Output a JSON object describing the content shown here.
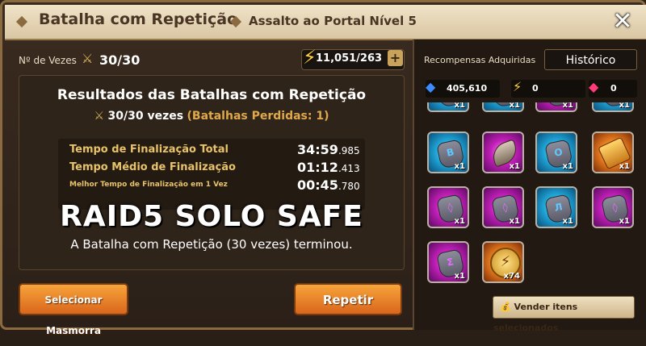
{
  "header": {
    "title": "Batalha com Repetição",
    "subtitle": "Assalto ao Portal Nível 5",
    "close_icon": "close-icon"
  },
  "left": {
    "count_label": "Nº de Vezes",
    "count_value": "30/30",
    "energy_value": "11,051/263",
    "plus_label": "+",
    "results_title": "Resultados das Batalhas com Repetição",
    "wins_text": "30/30 vezes",
    "losses_text": "(Batalhas Perdidas: 1)",
    "times": [
      {
        "label": "Tempo de Finalização Total",
        "main": "34:59",
        "ms": ".985"
      },
      {
        "label": "Tempo Médio de Finalização",
        "main": "01:12",
        "ms": ".413"
      },
      {
        "label": "Melhor Tempo de Finalização em 1 Vez",
        "main": "00:45",
        "ms": ".780"
      }
    ],
    "overlay_text": "RAID5 SOLO SAFE",
    "ended_text": "A Batalha com Repetição (30 vezes) terminou.",
    "select_dungeon_label": "Selecionar Masmorra",
    "repeat_label": "Repetir"
  },
  "right": {
    "rewards_label": "Recompensas Adquiridas",
    "history_label": "Histórico",
    "crystals": "405,610",
    "energy": "0",
    "gems": "0",
    "sell_label": "Vender itens selecionados",
    "items": [
      {
        "bg": "blue",
        "glyph": "",
        "qty": "x1"
      },
      {
        "bg": "blue",
        "glyph": "",
        "qty": "x1"
      },
      {
        "bg": "purple",
        "glyph": "",
        "qty": "x1"
      },
      {
        "bg": "blue",
        "glyph": "",
        "qty": "x1"
      },
      {
        "bg": "blue",
        "glyph": "B",
        "qty": "x1",
        "glyph_color": "#5ec8ff"
      },
      {
        "bg": "purple",
        "glyph": "",
        "qty": "x1",
        "kind": "fang"
      },
      {
        "bg": "blue",
        "glyph": "O",
        "qty": "x1",
        "glyph_color": "#5ec8ff"
      },
      {
        "bg": "orange",
        "glyph": "",
        "qty": "x1",
        "kind": "scroll"
      },
      {
        "bg": "purple",
        "glyph": "◊",
        "qty": "x1",
        "glyph_color": "#e86bff"
      },
      {
        "bg": "purple",
        "glyph": "◊",
        "qty": "x1",
        "glyph_color": "#e86bff"
      },
      {
        "bg": "blue",
        "glyph": "Л",
        "qty": "x1",
        "glyph_color": "#5ec8ff"
      },
      {
        "bg": "purple",
        "glyph": "◊",
        "qty": "x1",
        "glyph_color": "#e86bff"
      },
      {
        "bg": "purple",
        "glyph": "Σ",
        "qty": "x1",
        "glyph_color": "#e86bff"
      },
      {
        "bg": "orange",
        "glyph": "",
        "qty": "x74",
        "kind": "coin"
      }
    ]
  }
}
